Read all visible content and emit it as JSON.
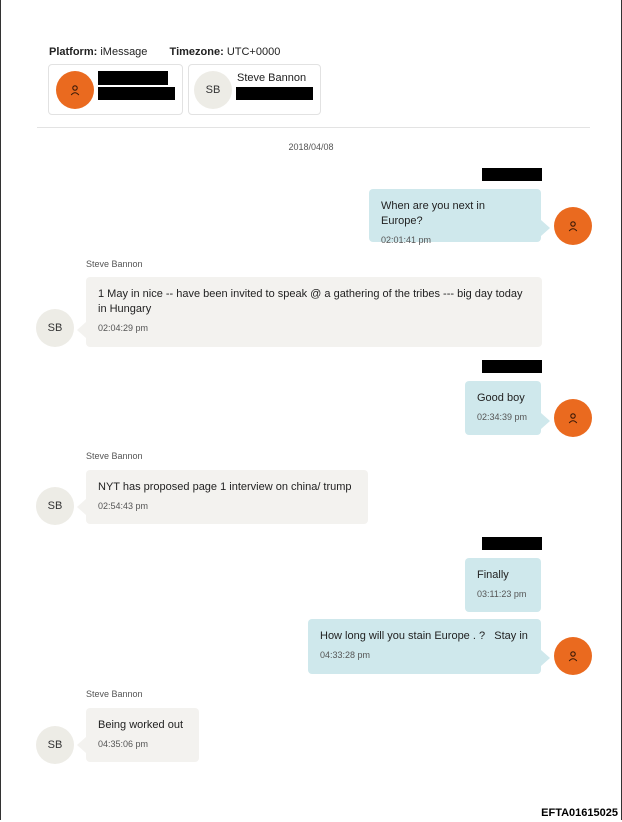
{
  "header": {
    "platform_label": "Platform:",
    "platform_value": "iMessage",
    "timezone_label": "Timezone:",
    "timezone_value": "UTC+0000"
  },
  "participants": [
    {
      "initials": "",
      "name": "",
      "icon": "person-icon",
      "color": "#ea6a1f"
    },
    {
      "initials": "SB",
      "name": "Steve Bannon",
      "color": "#edece6"
    }
  ],
  "date_divider": "2018/04/08",
  "messages": [
    {
      "direction": "out",
      "text": "When are you next in Europe?",
      "time": "02:01:41 pm"
    },
    {
      "direction": "in",
      "sender": "Steve Bannon",
      "initials": "SB",
      "text": "1 May in nice -- have been invited to speak @ a gathering of the tribes --- big day today in Hungary",
      "time": "02:04:29 pm"
    },
    {
      "direction": "out",
      "text": "Good boy",
      "time": "02:34:39 pm"
    },
    {
      "direction": "in",
      "sender": "Steve Bannon",
      "initials": "SB",
      "text": "NYT has proposed page 1 interview on china/ trump",
      "time": "02:54:43 pm"
    },
    {
      "direction": "out",
      "text": "Finally",
      "time": "03:11:23 pm"
    },
    {
      "direction": "out",
      "text": "How long will you stain Europe . ?   Stay in",
      "time": "04:33:28 pm"
    },
    {
      "direction": "in",
      "sender": "Steve Bannon",
      "initials": "SB",
      "text": "Being worked out",
      "time": "04:35:06 pm"
    }
  ],
  "footer_id": "EFTA01615025",
  "colors": {
    "outgoing_bubble": "#cfe8ec",
    "incoming_bubble": "#f3f2ef",
    "user_avatar": "#ea6a1f"
  }
}
